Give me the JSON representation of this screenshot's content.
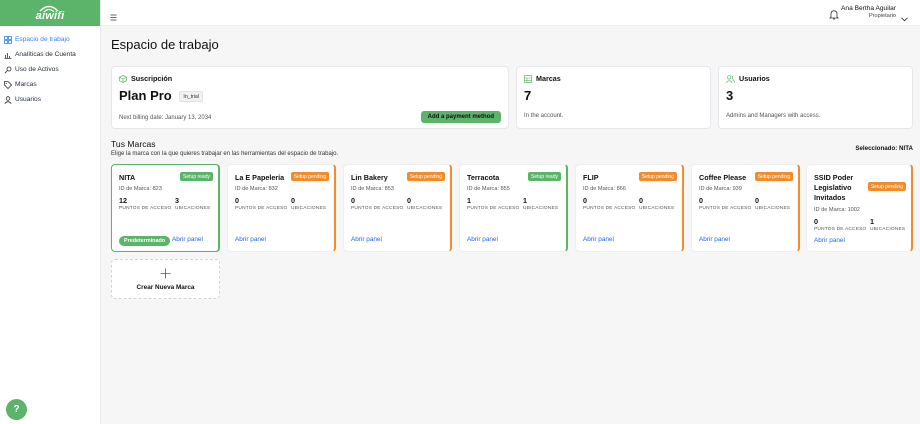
{
  "app": {
    "logo_text": "aiwifi"
  },
  "sidebar": {
    "items": [
      {
        "label": "Espacio de trabajo",
        "icon": "grid-icon",
        "active": true
      },
      {
        "label": "Analíticas de Cuenta",
        "icon": "chart-icon",
        "active": false
      },
      {
        "label": "Uso de Activos",
        "icon": "key-icon",
        "active": false
      },
      {
        "label": "Marcas",
        "icon": "tag-icon",
        "active": false
      },
      {
        "label": "Usuarios",
        "icon": "user-icon",
        "active": false
      }
    ]
  },
  "help": {
    "label": "?"
  },
  "topbar": {
    "user_name": "Ana Bertha Aguilar",
    "user_role": "Propietario"
  },
  "page": {
    "title": "Espacio de trabajo"
  },
  "subscription": {
    "title": "Suscripción",
    "plan": "Plan Pro",
    "status": "In_trial",
    "billing": "Next billing date: January 13, 2034",
    "pay_button": "Add a payment method"
  },
  "brands_summary": {
    "title": "Marcas",
    "count": "7",
    "note": "In the account."
  },
  "users_summary": {
    "title": "Usuarios",
    "count": "3",
    "note": "Admins and Managers with access."
  },
  "section": {
    "title": "Tus Marcas",
    "subtitle": "Elige la marca con la que quieres trabajar en las herramientas del espacio de trabajo.",
    "selected": "Seleccionado: NITA"
  },
  "labels": {
    "access_points": "PUNTOS DE ACCESO",
    "locations": "UBICACIONES",
    "open": "Abrir panel",
    "default": "Predeterminado"
  },
  "brands": [
    {
      "name": "NITA",
      "status": "Setup ready",
      "id": "ID de Marca: 823",
      "ap": "12",
      "loc": "3"
    },
    {
      "name": "La E Papelería",
      "status": "Setup pending",
      "id": "ID de Marca: 832",
      "ap": "0",
      "loc": "0"
    },
    {
      "name": "Lin Bakery",
      "status": "Setup pending",
      "id": "ID de Marca: 853",
      "ap": "0",
      "loc": "0"
    },
    {
      "name": "Terracota",
      "status": "Setup ready",
      "id": "ID de Marca: 855",
      "ap": "1",
      "loc": "1"
    },
    {
      "name": "FLIP",
      "status": "Setup pending",
      "id": "ID de Marca: 866",
      "ap": "0",
      "loc": "0"
    },
    {
      "name": "Coffee Please",
      "status": "Setup pending",
      "id": "ID de Marca: 939",
      "ap": "0",
      "loc": "0"
    },
    {
      "name": "SSID Poder Legislativo Invitados",
      "status": "Setup pending",
      "id": "ID de Marca: 1002",
      "ap": "0",
      "loc": "1"
    }
  ],
  "create": {
    "label": "Crear Nueva Marca"
  }
}
